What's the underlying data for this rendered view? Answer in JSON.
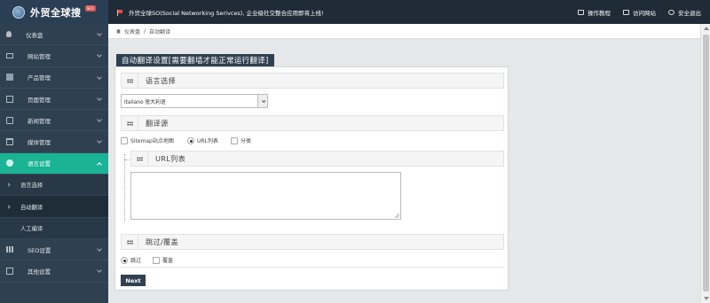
{
  "brand": {
    "name": "外贸全球搜",
    "badge": "SEO"
  },
  "notice": "外贸全球SO(Social Networking Serivces), 企业级社交整合应用即将上线!",
  "top_links": [
    {
      "label": "操作教程",
      "icon": "book-icon"
    },
    {
      "label": "访问网站",
      "icon": "monitor-icon"
    },
    {
      "label": "安全退出",
      "icon": "logout-icon"
    }
  ],
  "sidebar": {
    "items": [
      {
        "label": "仪表盘",
        "icon": "user-icon",
        "expanded": false
      },
      {
        "label": "网站管理",
        "icon": "monitor-icon",
        "expanded": false
      },
      {
        "label": "产品管理",
        "icon": "cube-icon",
        "expanded": false
      },
      {
        "label": "页面管理",
        "icon": "document-icon",
        "expanded": false
      },
      {
        "label": "新闻管理",
        "icon": "news-icon",
        "expanded": false
      },
      {
        "label": "媒体管理",
        "icon": "media-icon",
        "expanded": false
      },
      {
        "label": "语言设置",
        "icon": "globe-icon",
        "expanded": true
      },
      {
        "label": "SEO设置",
        "icon": "bar-chart-icon",
        "expanded": false
      },
      {
        "label": "其他设置",
        "icon": "settings-icon",
        "expanded": false
      }
    ],
    "sub_items": [
      {
        "label": "语言选择"
      },
      {
        "label": "自动翻译",
        "current": true
      },
      {
        "label": "人工编译"
      }
    ]
  },
  "breadcrumb": {
    "home": "仪表盘",
    "separator": "/",
    "current": "自动翻译"
  },
  "panel_title": "自动翻译设置[需要翻墙才能正常运行翻译]",
  "sections": {
    "language": {
      "title": "语言选择",
      "selected": "Italiano 意大利语"
    },
    "source": {
      "title": "翻译源",
      "options": [
        {
          "label": "Sitemap站点地图",
          "type": "checkbox",
          "checked": false
        },
        {
          "label": "URL列表",
          "type": "radio",
          "checked": true
        },
        {
          "label": "分类",
          "type": "checkbox",
          "checked": false
        }
      ]
    },
    "url_list": {
      "title": "URL列表",
      "value": ""
    },
    "skip": {
      "title": "跳过/覆盖",
      "options": [
        {
          "label": "跳过",
          "type": "radio",
          "checked": true
        },
        {
          "label": "覆盖",
          "type": "checkbox",
          "checked": false
        }
      ]
    }
  },
  "buttons": {
    "next": "Next"
  },
  "colors": {
    "sidebar": "#2f4050",
    "active": "#1ab394",
    "topbar": "#1f2b36"
  }
}
